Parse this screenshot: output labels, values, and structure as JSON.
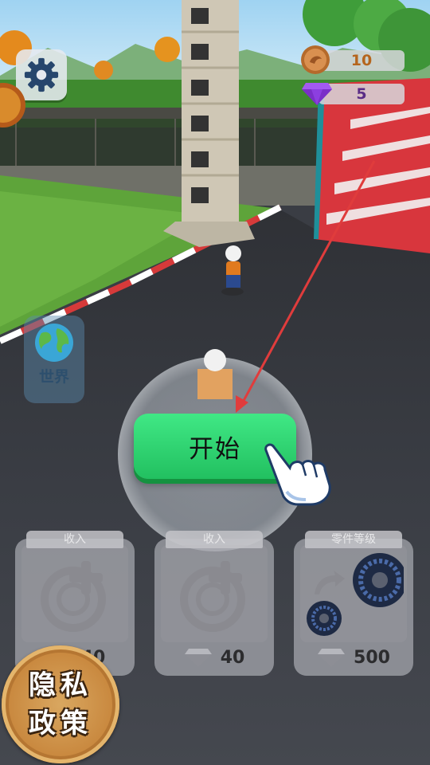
{
  "hud": {
    "settings_icon": "gear-icon",
    "coins": {
      "icon": "coin-icon",
      "value": "10",
      "color": "#b5651d"
    },
    "gems": {
      "icon": "gem-icon",
      "value": "5",
      "color": "#7a2fc8"
    }
  },
  "world_button": {
    "icon": "globe-icon",
    "label": "世界"
  },
  "start_button": {
    "label": "开始",
    "color": "#2fd673"
  },
  "tutorial": {
    "pointer_icon": "pointing-hand-icon",
    "arrow_color": "#e03c3c"
  },
  "upgrade_cards": [
    {
      "tab_label": "收入",
      "icon": "tire-plus-icon",
      "price_icon": "diamond-icon",
      "price": "40"
    },
    {
      "tab_label": "收入",
      "icon": "tire-plus-icon",
      "price_icon": "diamond-icon",
      "price": "40"
    },
    {
      "tab_label": "零件等级",
      "icon": "tire-upgrade-icon",
      "price_icon": "diamond-icon",
      "price": "500"
    }
  ],
  "privacy_badge": {
    "label": "隐私政策"
  }
}
